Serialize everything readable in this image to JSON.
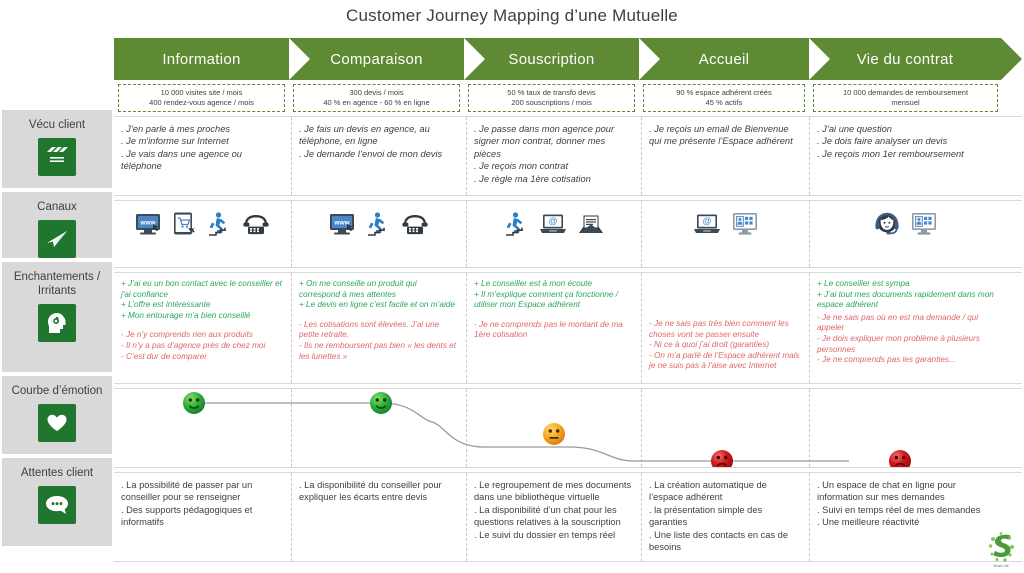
{
  "title": "Customer Journey Mapping d’une Mutuelle",
  "accent_green": "#5d8a33",
  "icon_green": "#21762f",
  "sidebar_bg": "#d9d9d9",
  "positive_color": "#2aa85a",
  "negative_color": "#e06666",
  "sidebar": {
    "items": [
      {
        "label": "Vécu client",
        "icon": "clapperboard-icon"
      },
      {
        "label": "Canaux",
        "icon": "paper-plane-icon"
      },
      {
        "label": "Enchantements /\nIrritants",
        "icon": "head-idea-icon"
      },
      {
        "label": "Courbe d’émotion",
        "icon": "heart-icon"
      },
      {
        "label": "Attentes client",
        "icon": "speech-bubble-icon"
      }
    ]
  },
  "stages": [
    {
      "name": "Information",
      "kpi": "10 000 visites site / mois\n400 rendez-vous agence / mois"
    },
    {
      "name": "Comparaison",
      "kpi": "300 devis / mois\n40 % en agence - 60 % en ligne"
    },
    {
      "name": "Souscription",
      "kpi": "50 % taux de transfo devis\n200 souscriptions / mois"
    },
    {
      "name": "Accueil",
      "kpi": "90 % espace adhérent créés\n45 % actifs"
    },
    {
      "name": "Vie du contrat",
      "kpi": "10 000 demandes de remboursement\nmensuel"
    }
  ],
  "experience": [
    ". J’en parle à mes proches\n. Je m'informe sur Internet\n. Je vais dans une agence ou téléphone",
    ". Je fais un devis en agence, au téléphone, en ligne\n. Je demande l’envoi de mon devis",
    ". Je passe dans mon agence pour signer mon contrat, donner mes pièces\n. Je reçois mon contrat\n. Je règle ma 1ère cotisation",
    ". Je reçois un email de Bienvenue qui me présente l’Espace adhérent",
    ". J’ai une question\n. Je dois faire analyser un devis\n. Je reçois mon 1er remboursement"
  ],
  "channels": [
    [
      "website-icon",
      "tablet-shop-icon",
      "person-stairs-icon",
      "telephone-icon"
    ],
    [
      "website-icon",
      "person-stairs-icon",
      "telephone-icon"
    ],
    [
      "person-stairs-icon",
      "laptop-email-icon",
      "open-envelope-icon"
    ],
    [
      "laptop-email-icon",
      "monitor-account-icon"
    ],
    [
      "headset-agent-icon",
      "monitor-account-icon"
    ]
  ],
  "delights": [
    "+ J’ai eu un bon contact avec le conseiller et j'ai confiance\n+ L’offre est intéressante\n+ Mon entourage m’a bien conseillé",
    "+ On me conseille un produit qui correspond à mes attentes\n+ Le devis en ligne c’est facile et on m’aide",
    "+ Le conseiller est à mon écoute\n+ Il m’explique comment ça fonctionne / utiliser mon Espace adhérent",
    "",
    "+ Le conseiller est sympa\n+ J’ai tout mes documents rapidement dans mon espace adhérent"
  ],
  "irritants": [
    "- Je n’y comprends rien aux produits\n- Il n’y a pas d’agence près de chez moi\n- C’est dur de comparer",
    "- Les cotisations sont élevées. J’ai une petite retraite.\n- Ils ne remboursent pas bien « les dents et les lunettes »",
    "- Je ne comprends pas le montant de ma 1ère cotisation",
    "- Je ne sais pas très bien comment les choses vont se passer ensuite\n- Ni ce à quoi j’ai droit (garanties)\n- On m’a parlé de l’Espace adhérent mais je ne suis pas à l’aise avec Internet",
    "- Je ne sais pas où en est ma demande / qui appeler\n- Je dois expliquer mon problème à plusieurs personnes\n- Je ne comprends pas les garanties..."
  ],
  "expectations": [
    ". La possibilité de passer par un conseiller pour se renseigner\n. Des supports pédagogiques et informatifs",
    ". La disponibilité du conseiller pour expliquer les écarts entre devis",
    ". Le regroupement de mes documents dans une bibliothèque virtuelle\n. La disponibilité d’un chat pour les questions relatives à la souscription\n. Le suivi du dossier en temps réel",
    ". La création automatique de l’espace adhérent\n. la présentation simple des garanties\n. Une liste des contacts en cas de besoins",
    ". Un espace de chat en ligne pour information sur mes demandes\n. Suivi en temps réel de mes demandes\n. Une meilleure réactivité"
  ],
  "chart_data": {
    "type": "line",
    "title": "Courbe d’émotion",
    "categories": [
      "Information",
      "Comparaison",
      "Souscription",
      "Accueil",
      "Vie du contrat"
    ],
    "values": [
      3,
      3,
      2,
      1,
      1
    ],
    "ylim": [
      1,
      3
    ],
    "point_labels": [
      "happy",
      "happy",
      "neutral",
      "sad",
      "sad"
    ],
    "point_colors": [
      "#22aa33",
      "#22aa33",
      "#f0a22a",
      "#cc1111",
      "#cc1111"
    ],
    "grid": false,
    "legend": "none",
    "xlabel": "",
    "ylabel": ""
  }
}
